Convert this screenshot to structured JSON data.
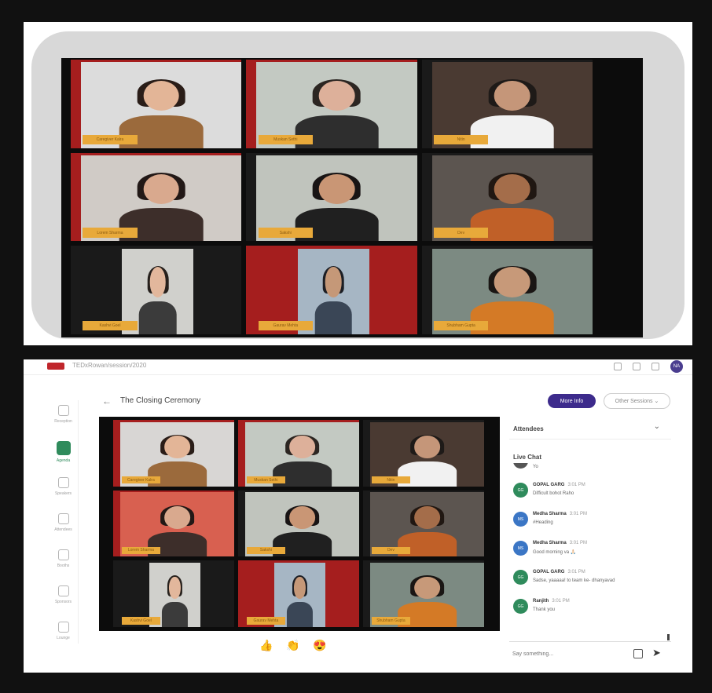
{
  "top_grid": {
    "tiles": [
      {
        "name": "Caregiver Kalra",
        "bg": "#dcdcdc",
        "skin": "#e3b597",
        "hair": "#2a1d18",
        "shirt": "#9b6a3c",
        "frame": "red",
        "portrait": false
      },
      {
        "name": "Muskan Sethi",
        "bg": "#c3c9c2",
        "skin": "#ddb09a",
        "hair": "#2c2622",
        "shirt": "#2e2e2e",
        "frame": "red",
        "portrait": false
      },
      {
        "name": "Nitin",
        "bg": "#4a3a32",
        "skin": "#c59679",
        "hair": "#1e1a18",
        "shirt": "#f1f1f1",
        "frame": "dark",
        "portrait": false
      },
      {
        "name": "Lorem Sharma",
        "bg": "#d0cbc6",
        "skin": "#d9a98e",
        "hair": "#221816",
        "shirt": "#3d2e2a",
        "frame": "red",
        "portrait": false
      },
      {
        "name": "Sakshi",
        "bg": "#c0c4bd",
        "skin": "#c99675",
        "hair": "#181414",
        "shirt": "#202020",
        "frame": "dark",
        "portrait": false
      },
      {
        "name": "Dev",
        "bg": "#5c5550",
        "skin": "#a46d4a",
        "hair": "#201712",
        "shirt": "#c06028",
        "frame": "dark",
        "portrait": false
      },
      {
        "name": "Kashvi Goel",
        "bg": "#d0d0cc",
        "skin": "#e2b79c",
        "hair": "#26201c",
        "shirt": "#3b3b3b",
        "frame": "dark",
        "portrait": true
      },
      {
        "name": "Gaurav Mehta",
        "bg": "#a6b6c4",
        "skin": "#c59878",
        "hair": "#1c1e24",
        "shirt": "#3a4656",
        "frame": "red",
        "portrait": true
      },
      {
        "name": "Shubham Gupta",
        "bg": "#7c8a82",
        "skin": "#c79979",
        "hair": "#1a1614",
        "shirt": "#d47a26",
        "frame": "dark",
        "portrait": false
      }
    ]
  },
  "app": {
    "url": "TEDxRowan/session/2020",
    "avatar_initials": "NA",
    "nav": [
      {
        "label": "Reception",
        "active": false
      },
      {
        "label": "Agenda",
        "active": true
      },
      {
        "label": "Speakers",
        "active": false
      },
      {
        "label": "Attendees",
        "active": false
      },
      {
        "label": "Booths",
        "active": false
      },
      {
        "label": "Sponsors",
        "active": false
      },
      {
        "label": "Lounge",
        "active": false
      }
    ],
    "back_icon": "←",
    "session_title": "The Closing Ceremony",
    "more_info": "More Info",
    "other_sessions": "Other Sessions ⌄",
    "reactions": [
      "👍",
      "👏",
      "😍"
    ]
  },
  "bottom_grid": {
    "tiles": [
      {
        "name": "Caregiver Kalra",
        "bg": "#d8d6d4",
        "skin": "#e3b597",
        "hair": "#2a1d18",
        "shirt": "#9b6a3c",
        "frame": "red",
        "portrait": false
      },
      {
        "name": "Muskan Sethi",
        "bg": "#c3c9c2",
        "skin": "#ddb09a",
        "hair": "#2c2622",
        "shirt": "#2e2e2e",
        "frame": "red",
        "portrait": false
      },
      {
        "name": "Nitin",
        "bg": "#4a3a32",
        "skin": "#c59679",
        "hair": "#1e1a18",
        "shirt": "#f1f1f1",
        "frame": "dark",
        "portrait": false
      },
      {
        "name": "Lorem Sharma",
        "bg": "#d86050",
        "skin": "#d9a98e",
        "hair": "#221816",
        "shirt": "#3d2e2a",
        "frame": "red",
        "portrait": false
      },
      {
        "name": "Sakshi",
        "bg": "#c0c4bd",
        "skin": "#c99675",
        "hair": "#181414",
        "shirt": "#202020",
        "frame": "dark",
        "portrait": false
      },
      {
        "name": "Dev",
        "bg": "#5c5550",
        "skin": "#a46d4a",
        "hair": "#201712",
        "shirt": "#c06028",
        "frame": "dark",
        "portrait": false
      },
      {
        "name": "Kashvi Goel",
        "bg": "#d0d0cc",
        "skin": "#e2b79c",
        "hair": "#26201c",
        "shirt": "#3b3b3b",
        "frame": "dark",
        "portrait": true
      },
      {
        "name": "Gaurav Mehta",
        "bg": "#a6b6c4",
        "skin": "#c59878",
        "hair": "#1c1e24",
        "shirt": "#3a4656",
        "frame": "red",
        "portrait": true
      },
      {
        "name": "Shubham Gupta",
        "bg": "#7c8a82",
        "skin": "#c79979",
        "hair": "#1a1614",
        "shirt": "#d47a26",
        "frame": "dark",
        "portrait": false
      }
    ]
  },
  "chat": {
    "attendees_label": "Attendees",
    "chevron": "⌄",
    "live_chat_label": "Live Chat",
    "partial_text": "Yo",
    "messages": [
      {
        "initials": "GG",
        "author": "GOPAL GARG",
        "time": "3:01 PM",
        "text": "Difficult bohot Raho",
        "color": "#2f8b5c"
      },
      {
        "initials": "MS",
        "author": "Medha Sharma",
        "time": "3:01 PM",
        "text": "#Heading",
        "color": "#3b76c5"
      },
      {
        "initials": "MS",
        "author": "Medha Sharma",
        "time": "3:01 PM",
        "text": "Good morning va 🙏🏻",
        "color": "#3b76c5"
      },
      {
        "initials": "GG",
        "author": "GOPAL GARG",
        "time": "3:01 PM",
        "text": "Sadse, yaaaaa! to team ke- dhanyavad",
        "color": "#2f8b5c"
      },
      {
        "initials": "GG",
        "author": "Ranjith",
        "time": "3:01 PM",
        "text": "Thank you",
        "color": "#2f8b5c"
      }
    ],
    "input_placeholder": "Say something...",
    "send_icon": "➤"
  },
  "colors": {
    "accent_purple": "#3d2b8c",
    "accent_green": "#2f8b5c",
    "name_tag": "#e8a93a",
    "stage_red": "#a51e1e"
  }
}
